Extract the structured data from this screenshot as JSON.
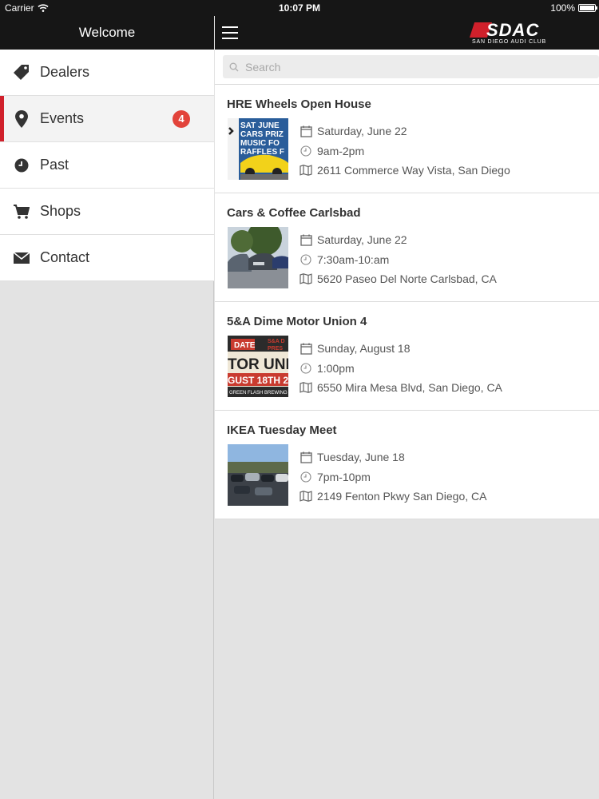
{
  "status": {
    "carrier": "Carrier",
    "time": "10:07 PM",
    "battery": "100%"
  },
  "sidebar": {
    "title": "Welcome",
    "items": [
      {
        "label": "Dealers",
        "icon": "tag-icon"
      },
      {
        "label": "Events",
        "icon": "map-pin-icon",
        "badge": "4",
        "active": true
      },
      {
        "label": "Past",
        "icon": "clock-icon"
      },
      {
        "label": "Shops",
        "icon": "cart-icon"
      },
      {
        "label": "Contact",
        "icon": "envelope-icon"
      }
    ]
  },
  "header": {
    "logo_text": "SDAC",
    "logo_sub": "SAN DIEGO AUDI CLUB"
  },
  "search": {
    "placeholder": "Search",
    "value": ""
  },
  "events": [
    {
      "title": "HRE Wheels Open House",
      "date": "Saturday, June 22",
      "time": "9am-2pm",
      "location": "2611 Commerce Way Vista, San Diego"
    },
    {
      "title": "Cars & Coffee Carlsbad",
      "date": "Saturday, June 22",
      "time": "7:30am-10:am",
      "location": "5620 Paseo Del Norte Carlsbad, CA"
    },
    {
      "title": "5&A Dime Motor Union 4",
      "date": "Sunday, August 18",
      "time": "1:00pm",
      "location": "6550 Mira Mesa Blvd, San Diego, CA"
    },
    {
      "title": "IKEA Tuesday Meet",
      "date": "Tuesday, June 18",
      "time": "7pm-10pm",
      "location": "2149 Fenton Pkwy San Diego, CA"
    }
  ],
  "thumb_text": {
    "hre": [
      "SAT JUNE",
      "CARS PRIZ",
      "MUSIC FO",
      "RAFFLES F"
    ],
    "motor_union": [
      "DATE",
      "S&A D",
      "PRES",
      "TOR UNIO",
      "GUST 18TH 2",
      "GREEN FLASH BREWING"
    ]
  },
  "colors": {
    "accent": "#d0202b",
    "badge": "#e2433a",
    "bar": "#161616"
  }
}
